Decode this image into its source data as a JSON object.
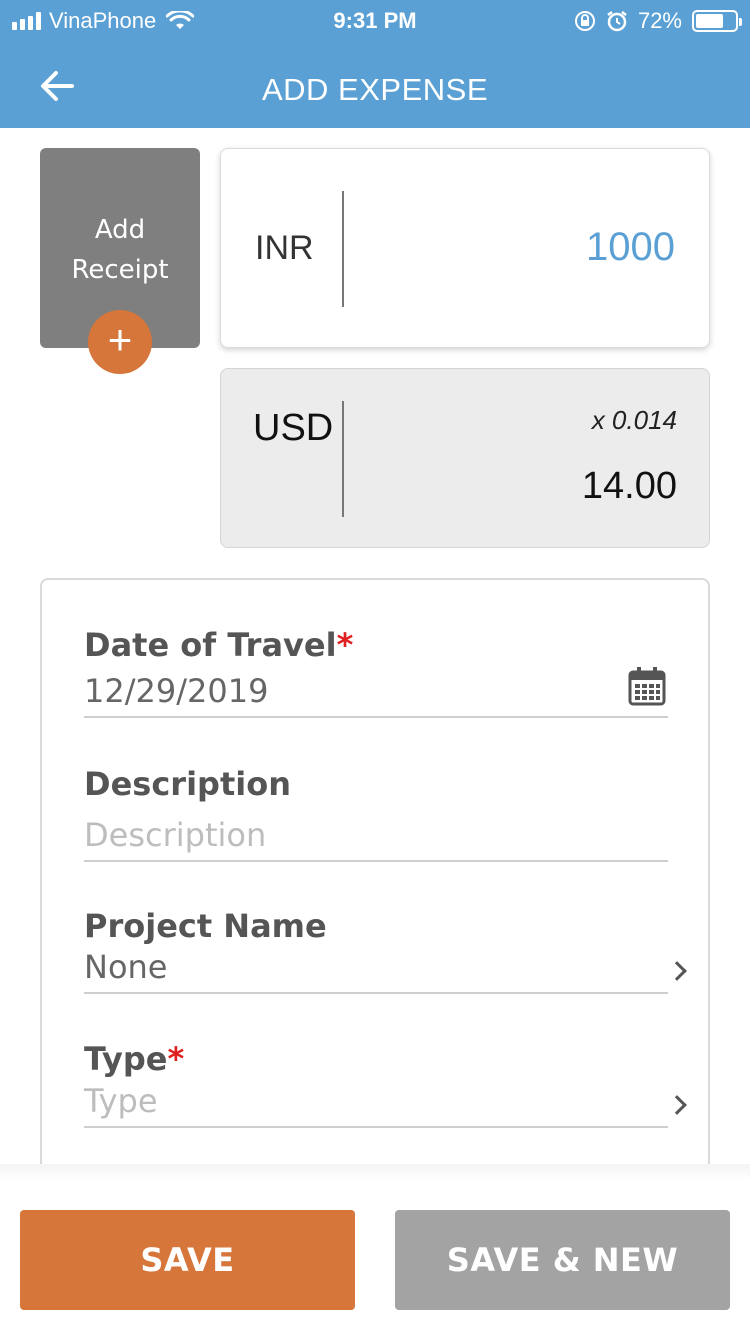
{
  "status_bar": {
    "carrier": "VinaPhone",
    "time": "9:31 PM",
    "battery_text": "72%",
    "battery_level": 0.72
  },
  "header": {
    "title": "ADD EXPENSE",
    "back_icon": "arrow-left-icon"
  },
  "receipt": {
    "label_line1": "Add",
    "label_line2": "Receipt",
    "add_glyph": "+"
  },
  "amount": {
    "currency": "INR",
    "value": "1000"
  },
  "converted": {
    "currency": "USD",
    "rate": "x 0.014",
    "value": "14.00"
  },
  "form": {
    "date": {
      "label": "Date of Travel",
      "required_mark": "*",
      "value": "12/29/2019",
      "icon": "calendar-icon"
    },
    "description": {
      "label": "Description",
      "placeholder": "Description"
    },
    "project": {
      "label": "Project Name",
      "value": "None",
      "icon": "chevron-right-icon"
    },
    "type": {
      "label": "Type",
      "required_mark": "*",
      "placeholder": "Type",
      "icon": "chevron-right-icon"
    }
  },
  "actions": {
    "save": "SAVE",
    "save_new": "SAVE & NEW"
  },
  "colors": {
    "header": "#5aa0d4",
    "accent": "#d6763a",
    "secondary_button": "#a3a3a3",
    "required": "#e02020"
  }
}
